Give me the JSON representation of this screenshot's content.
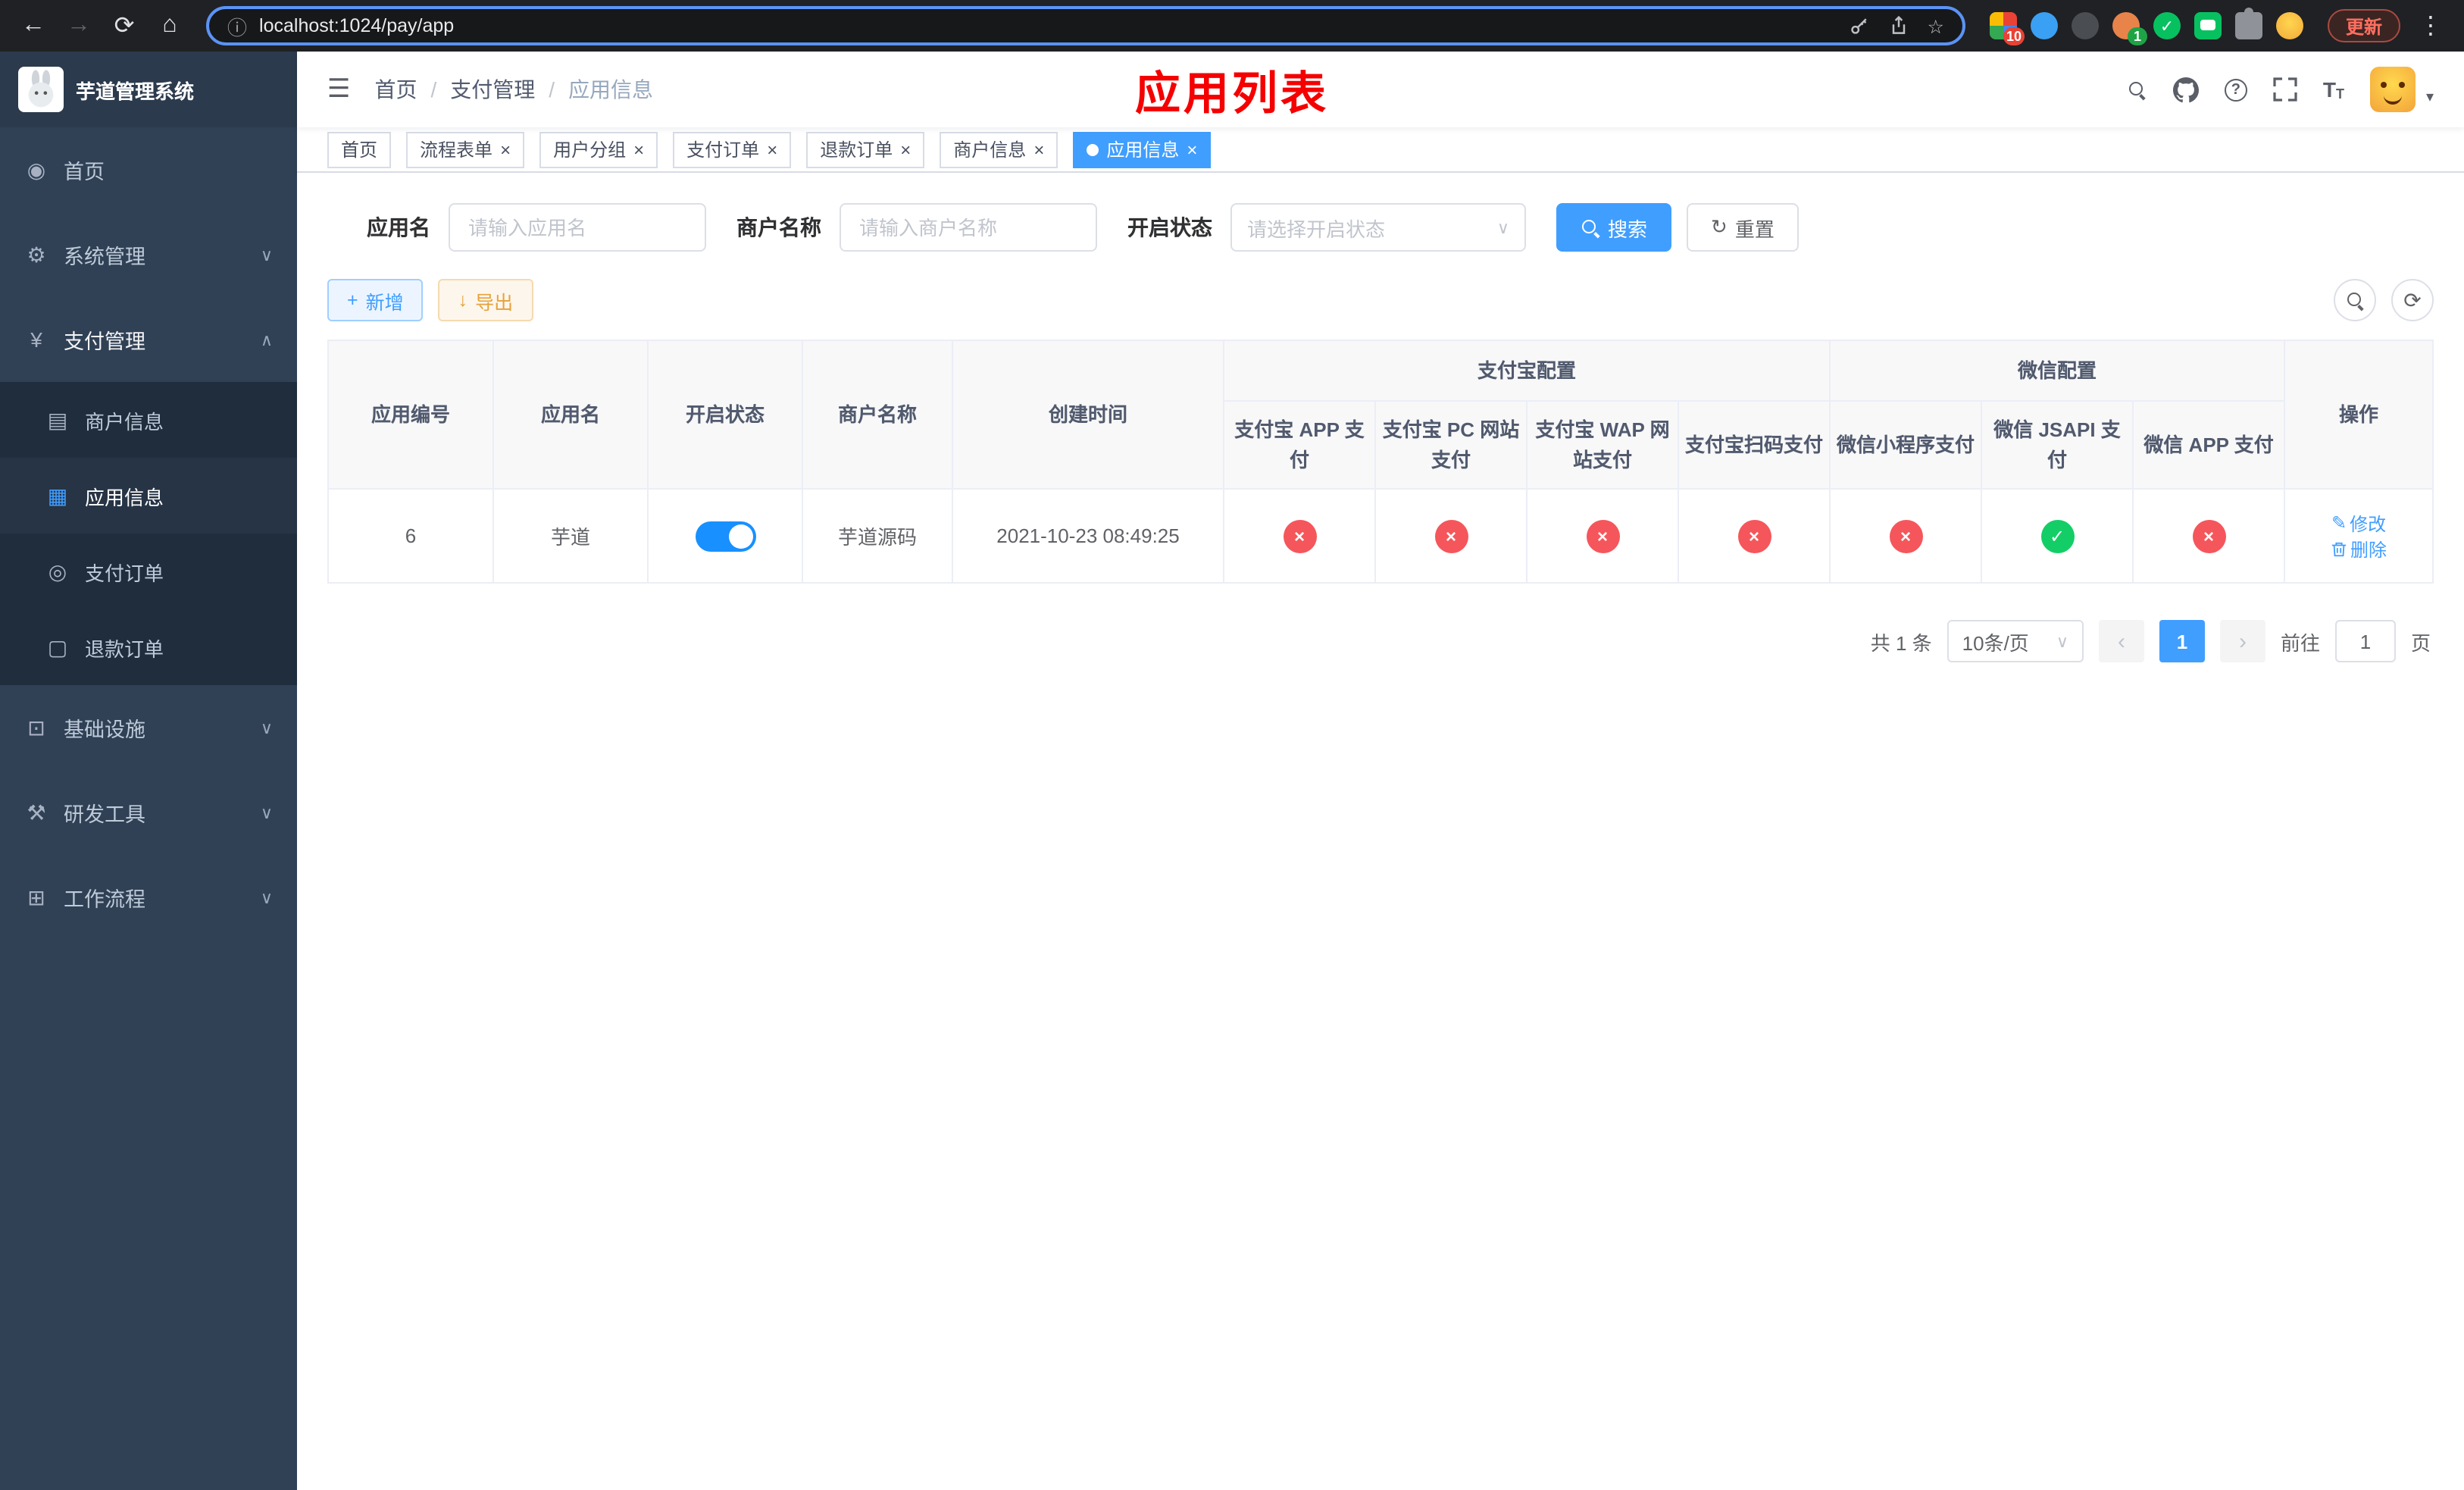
{
  "icons": {
    "back": "←",
    "forward": "→",
    "reload": "⟳",
    "home": "⌂",
    "info": "ⓘ",
    "star": "☆",
    "dots": "⋮",
    "hamburger": "☰",
    "question": "?",
    "dashboard": "◉",
    "gear": "⚙",
    "yen": "¥",
    "merchant": "▤",
    "app": "▦",
    "order": "◎",
    "refund": "▢",
    "infra": "⊡",
    "tools": "⚒",
    "flow": "⊞",
    "chevron_down": "∨",
    "chevron_up": "∧",
    "caret_down": "▾",
    "plus": "+",
    "download": "↓",
    "refresh": "↻",
    "sync": "⟳",
    "edit": "✎",
    "prev": "‹",
    "next": "›",
    "check": "✓",
    "cross": "×",
    "close": "×",
    "fontsize": "T"
  },
  "browser": {
    "url": "localhost:1024/pay/app",
    "update_label": "更新",
    "ext_badge": "10",
    "profile_badge": "1"
  },
  "sidebar": {
    "title": "芋道管理系统",
    "items": [
      {
        "label": "首页"
      },
      {
        "label": "系统管理"
      },
      {
        "label": "支付管理",
        "children": [
          {
            "label": "商户信息"
          },
          {
            "label": "应用信息"
          },
          {
            "label": "支付订单"
          },
          {
            "label": "退款订单"
          }
        ]
      },
      {
        "label": "基础设施"
      },
      {
        "label": "研发工具"
      },
      {
        "label": "工作流程"
      }
    ]
  },
  "header": {
    "breadcrumb": {
      "home": "首页",
      "section": "支付管理",
      "current": "应用信息",
      "sep": "/"
    },
    "page_title": "应用列表"
  },
  "tabs": [
    {
      "label": "首页"
    },
    {
      "label": "流程表单"
    },
    {
      "label": "用户分组"
    },
    {
      "label": "支付订单"
    },
    {
      "label": "退款订单"
    },
    {
      "label": "商户信息"
    },
    {
      "label": "应用信息"
    }
  ],
  "filters": {
    "app_name": {
      "label": "应用名",
      "placeholder": "请输入应用名"
    },
    "merchant": {
      "label": "商户名称",
      "placeholder": "请输入商户名称"
    },
    "status": {
      "label": "开启状态",
      "placeholder": "请选择开启状态"
    },
    "search": "搜索",
    "reset": "重置"
  },
  "toolbar": {
    "add": "新增",
    "export": "导出"
  },
  "table": {
    "groups": {
      "alipay": "支付宝配置",
      "wechat": "微信配置"
    },
    "columns": [
      "应用编号",
      "应用名",
      "开启状态",
      "商户名称",
      "创建时间",
      "支付宝 APP 支付",
      "支付宝 PC 网站支付",
      "支付宝 WAP 网站支付",
      "支付宝扫码支付",
      "微信小程序支付",
      "微信 JSAPI 支付",
      "微信 APP 支付",
      "操作"
    ],
    "row": {
      "id": "6",
      "name": "芋道",
      "enabled": true,
      "merchant": "芋道源码",
      "created": "2021-10-23 08:49:25",
      "statuses": [
        false,
        false,
        false,
        false,
        false,
        true,
        false
      ],
      "edit": "修改",
      "delete": "删除"
    }
  },
  "pagination": {
    "total": "共 1 条",
    "page_size": "10条/页",
    "page": "1",
    "goto": "前往",
    "goto_value": "1",
    "unit": "页"
  },
  "colors": {
    "primary": "#409eff",
    "danger": "#f56c6c",
    "success": "#13ce66",
    "sidebar": "#304156",
    "submenu": "#1f2d3d",
    "annotation": "#ff0000"
  }
}
